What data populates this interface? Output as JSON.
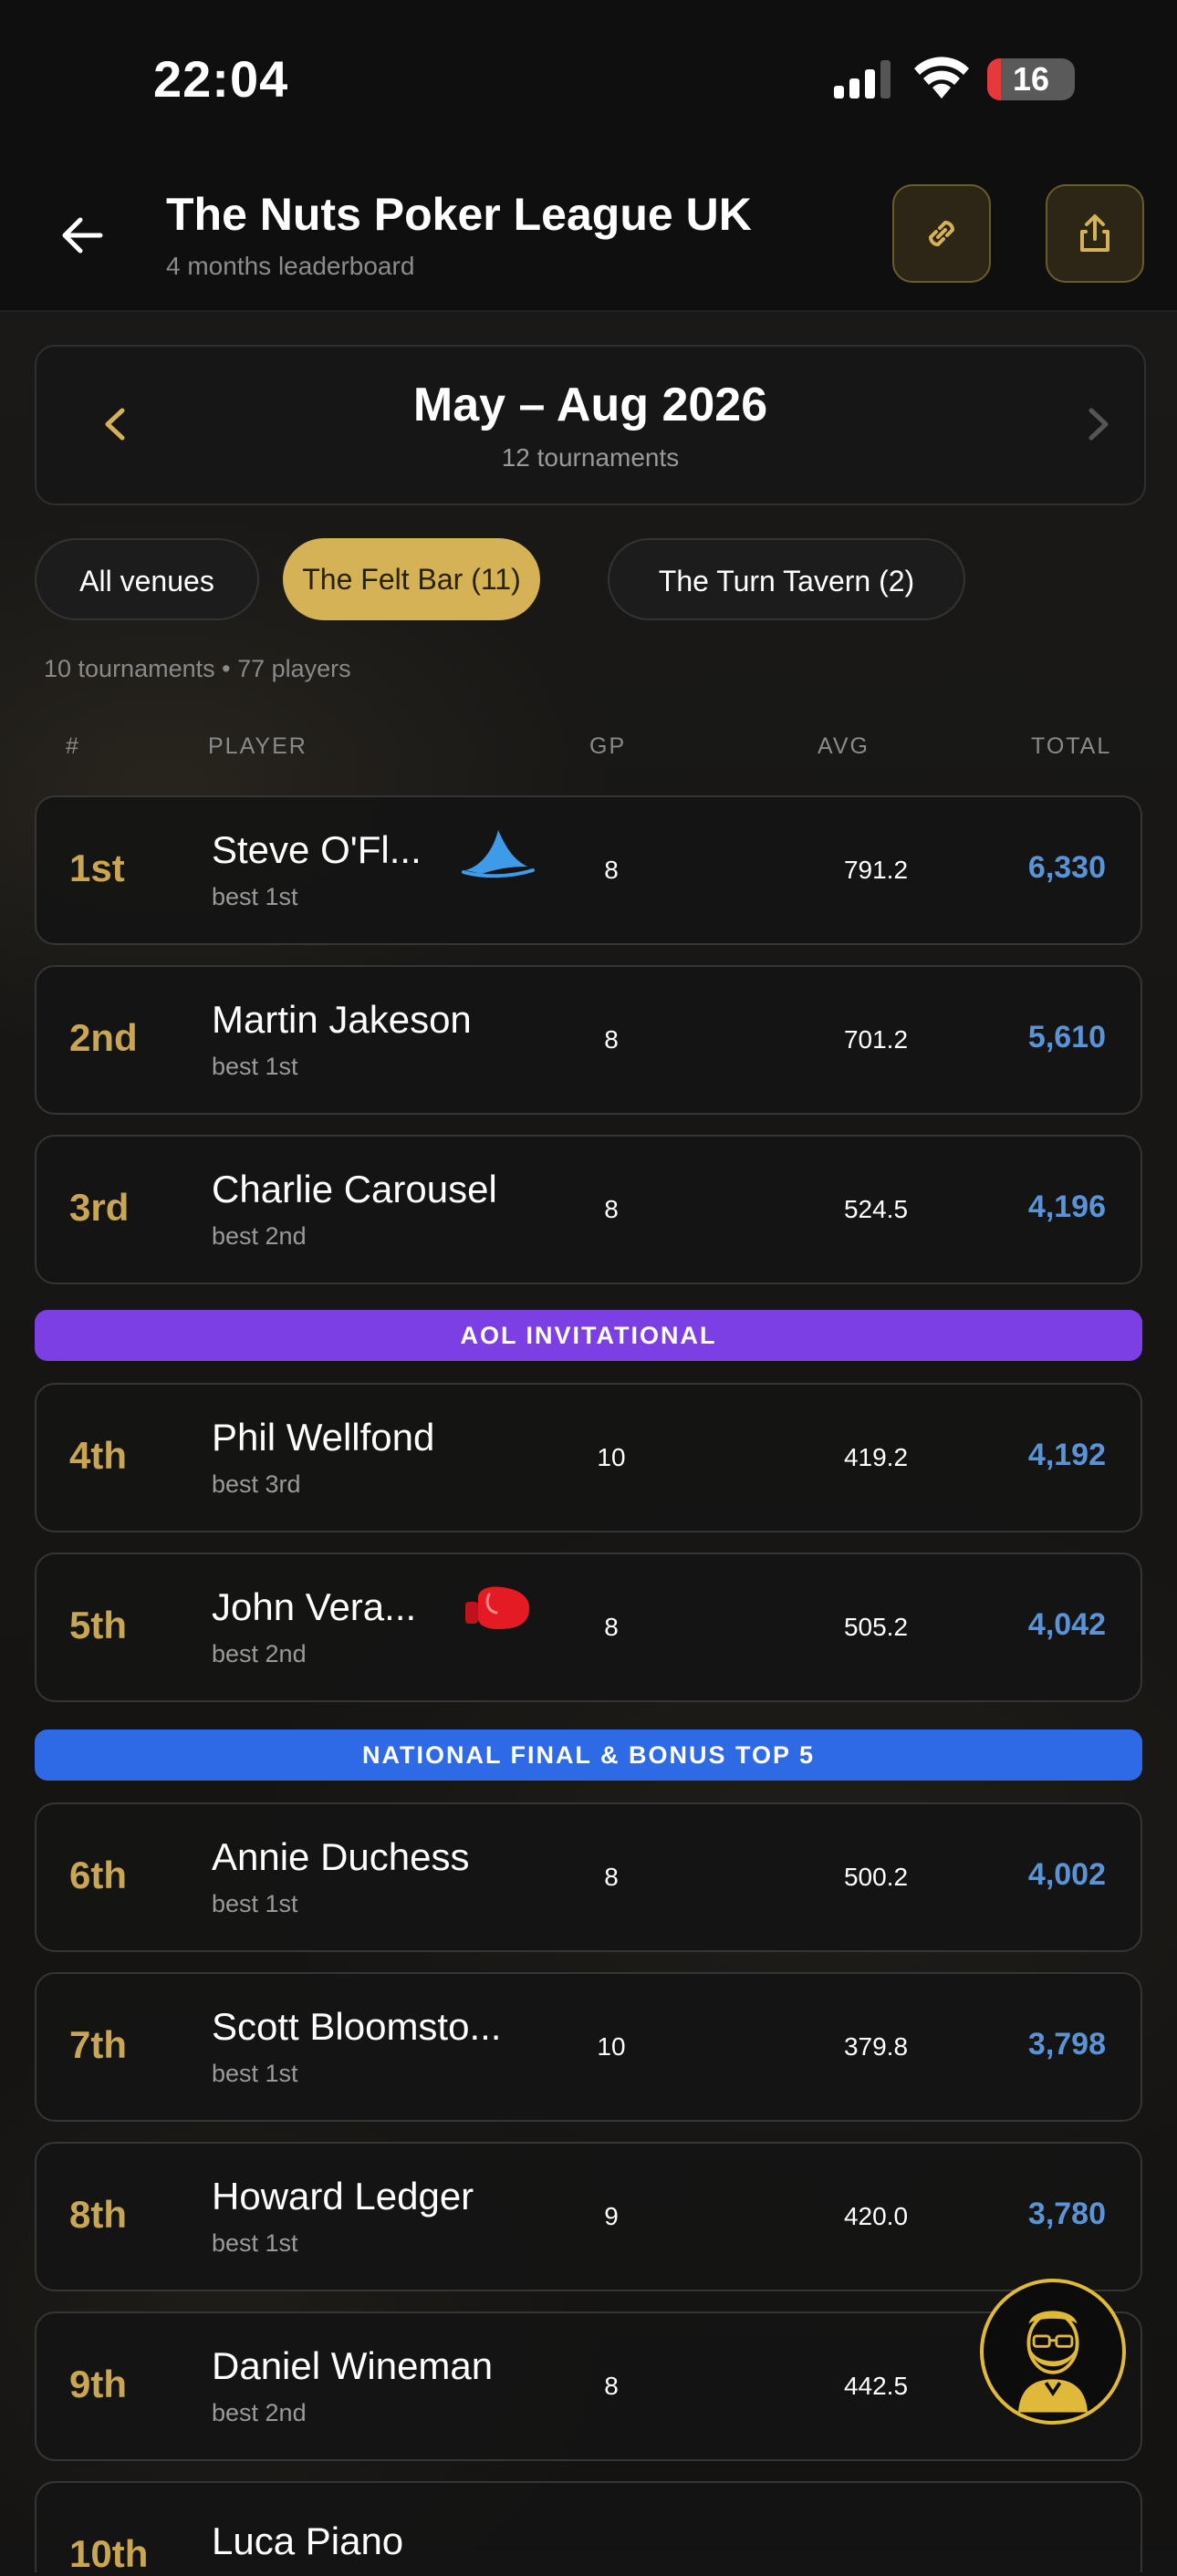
{
  "status": {
    "time": "22:04",
    "battery": "16",
    "battery_level": 0.16
  },
  "header": {
    "title": "The Nuts Poker League UK",
    "subtitle": "4 months leaderboard"
  },
  "period": {
    "title": "May – Aug 2026",
    "subtitle": "12 tournaments"
  },
  "venues": [
    {
      "label": "All venues",
      "selected": false
    },
    {
      "label": "The Felt Bar (11)",
      "selected": true
    },
    {
      "label": "The Turn Tavern (2)",
      "selected": false
    }
  ],
  "summary": "10 tournaments • 77 players",
  "columns": {
    "rank": "#",
    "player": "PLAYER",
    "gp": "GP",
    "avg": "AVG",
    "total": "TOTAL"
  },
  "banners": {
    "aol": {
      "label": "AOL INVITATIONAL",
      "color": "#7b3fe4"
    },
    "national": {
      "label": "NATIONAL FINAL & BONUS TOP 5",
      "color": "#2f6ae6"
    }
  },
  "players": [
    {
      "rank": "1st",
      "name": "Steve O'Fl...",
      "best": "best 1st",
      "gp": "8",
      "avg": "791.2",
      "total": "6,330",
      "icon": "shark-fin-icon"
    },
    {
      "rank": "2nd",
      "name": "Martin Jakeson",
      "best": "best 1st",
      "gp": "8",
      "avg": "701.2",
      "total": "5,610"
    },
    {
      "rank": "3rd",
      "name": "Charlie Carousel",
      "best": "best 2nd",
      "gp": "8",
      "avg": "524.5",
      "total": "4,196"
    },
    {
      "rank": "4th",
      "name": "Phil Wellfond",
      "best": "best 3rd",
      "gp": "10",
      "avg": "419.2",
      "total": "4,192"
    },
    {
      "rank": "5th",
      "name": "John Vera...",
      "best": "best 2nd",
      "gp": "8",
      "avg": "505.2",
      "total": "4,042",
      "icon": "boxing-glove-icon"
    },
    {
      "rank": "6th",
      "name": "Annie Duchess",
      "best": "best 1st",
      "gp": "8",
      "avg": "500.2",
      "total": "4,002"
    },
    {
      "rank": "7th",
      "name": "Scott Bloomsto...",
      "best": "best 1st",
      "gp": "10",
      "avg": "379.8",
      "total": "3,798"
    },
    {
      "rank": "8th",
      "name": "Howard Ledger",
      "best": "best 1st",
      "gp": "9",
      "avg": "420.0",
      "total": "3,780"
    },
    {
      "rank": "9th",
      "name": "Daniel Wineman",
      "best": "best 2nd",
      "gp": "8",
      "avg": "442.5",
      "total": ""
    },
    {
      "rank": "10th",
      "name": "Luca Piano",
      "best": "",
      "gp": "",
      "avg": "",
      "total": ""
    }
  ],
  "colors": {
    "accent_gold": "#d4b255",
    "rank_gold": "#c9a653",
    "total_blue": "#5b94d6"
  }
}
